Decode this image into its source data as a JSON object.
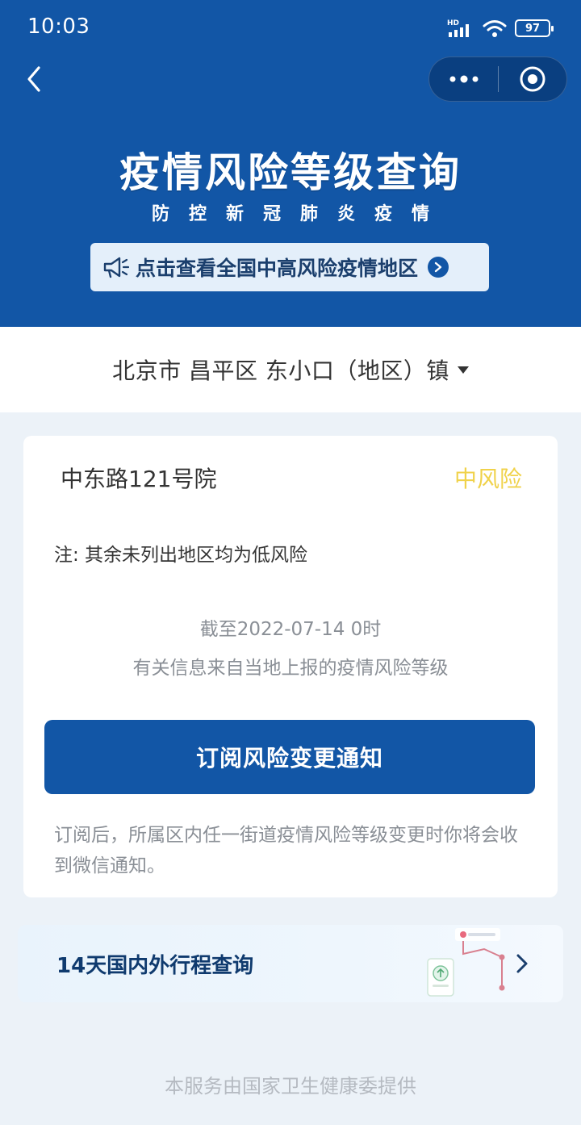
{
  "status_bar": {
    "time": "10:03",
    "network": "HD",
    "battery": "97"
  },
  "header": {
    "title": "疫情风险等级查询",
    "subtitle": "防控新冠肺炎疫情",
    "notice": "点击查看全国中高风险疫情地区",
    "background_color": "#1256a6"
  },
  "region": {
    "label": "北京市 昌平区 东小口（地区）镇"
  },
  "risk_card": {
    "area": "中东路121号院",
    "level": "中风险",
    "level_color": "#f0d24a",
    "note": "注: 其余未列出地区均为低风险",
    "as_of": "截至2022-07-14 0时",
    "source": "有关信息来自当地上报的疫情风险等级",
    "subscribe_button": "订阅风险变更通知",
    "subscribe_desc": "订阅后，所属区内任一街道疫情风险等级变更时你将会收到微信通知。"
  },
  "itinerary": {
    "label": "14天国内外行程查询"
  },
  "footer": {
    "text": "本服务由国家卫生健康委提供"
  },
  "icons": {
    "back": "chevron-left-icon",
    "more": "more-dots-icon",
    "close": "target-circle-icon",
    "megaphone": "megaphone-icon",
    "notice_arrow": "chevron-right-circle-icon",
    "dropdown": "caret-down-icon",
    "itinerary_arrow": "chevron-right-icon"
  }
}
